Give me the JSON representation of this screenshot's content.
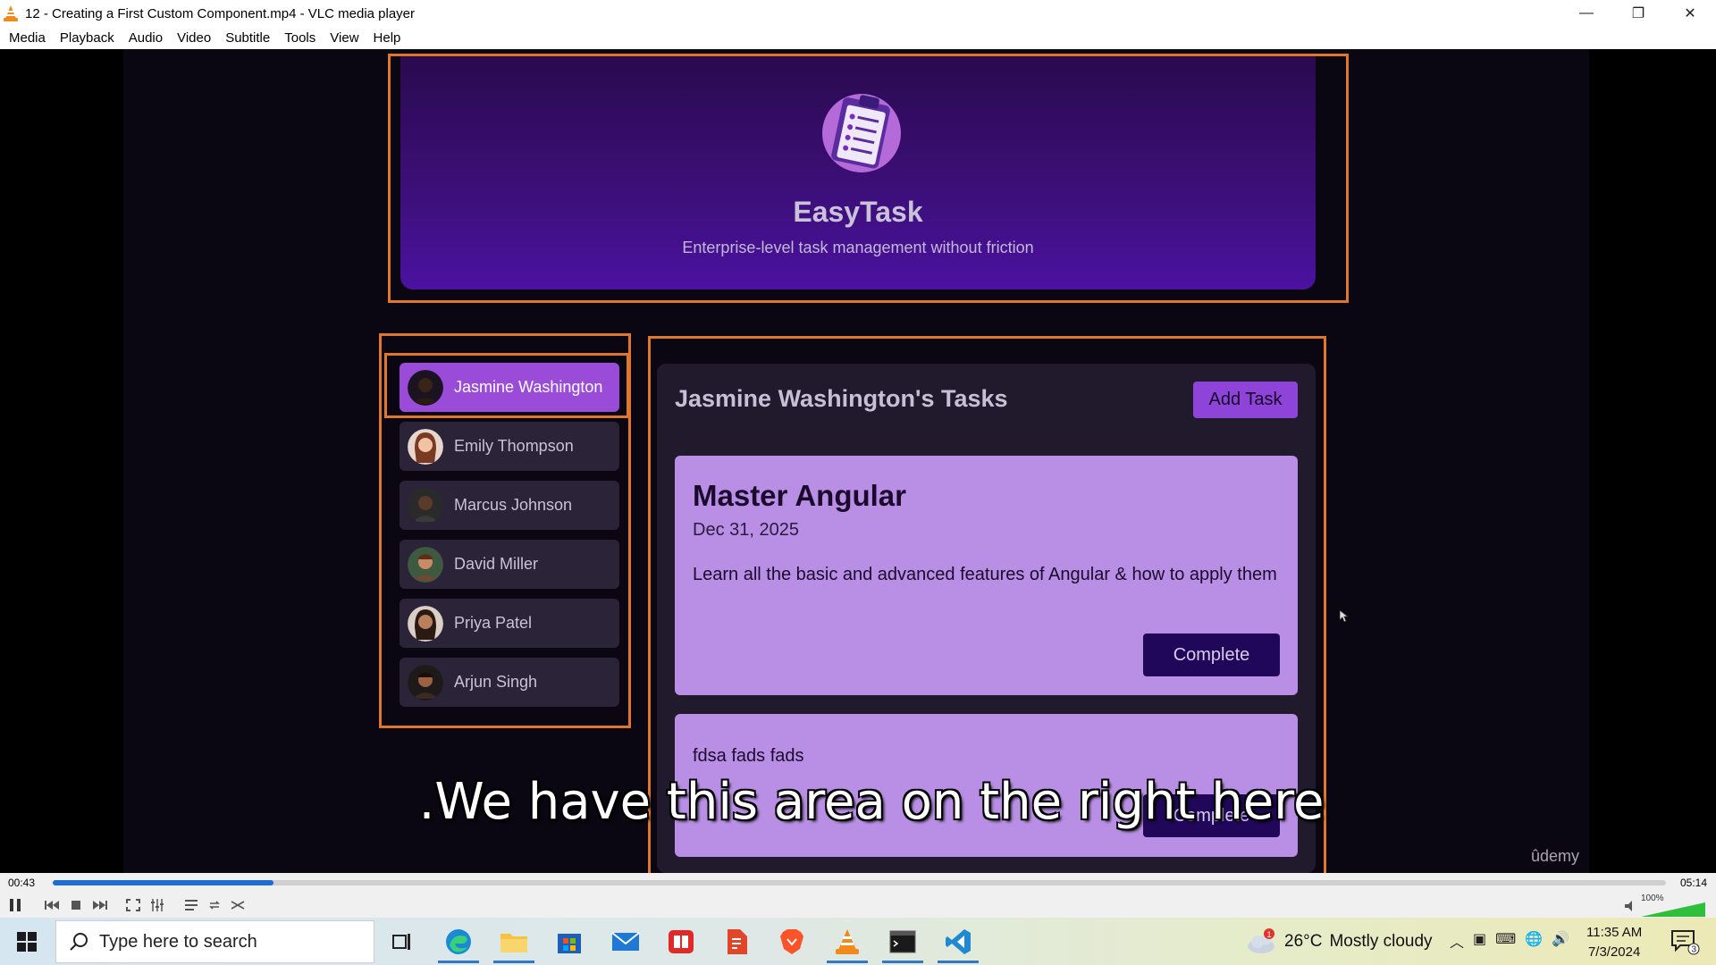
{
  "window": {
    "title": "12 - Creating a First Custom Component.mp4 - VLC media player",
    "controls": {
      "minimize": "—",
      "restore": "❐",
      "close": "✕"
    }
  },
  "menu": [
    "Media",
    "Playback",
    "Audio",
    "Video",
    "Subtitle",
    "Tools",
    "View",
    "Help"
  ],
  "video": {
    "app": {
      "name": "EasyTask",
      "tagline": "Enterprise-level task management without friction"
    },
    "users": [
      {
        "name": "Jasmine Washington",
        "active": true
      },
      {
        "name": "Emily Thompson",
        "active": false
      },
      {
        "name": "Marcus Johnson",
        "active": false
      },
      {
        "name": "David Miller",
        "active": false
      },
      {
        "name": "Priya Patel",
        "active": false
      },
      {
        "name": "Arjun Singh",
        "active": false
      }
    ],
    "tasks_title": "Jasmine Washington's Tasks",
    "add_task_label": "Add Task",
    "tasks": [
      {
        "title": "Master Angular",
        "date": "Dec 31, 2025",
        "description": "Learn all the basic and advanced features of Angular & how to apply them",
        "button": "Complete"
      },
      {
        "title": "",
        "date": "",
        "description": "fdsa fads fads",
        "button": "Complete"
      }
    ],
    "subtitle": ".We have this area on the right here",
    "watermark": "ûdemy"
  },
  "player": {
    "time_current": "00:43",
    "time_total": "05:14",
    "progress": 0.137,
    "volume_label": "100%"
  },
  "taskbar": {
    "search_placeholder": "Type here to search",
    "weather": {
      "temp": "26°C",
      "condition": "Mostly cloudy",
      "badge": "1"
    },
    "clock": {
      "time": "11:35 AM",
      "date": "7/3/2024"
    },
    "notification_count": "3"
  }
}
